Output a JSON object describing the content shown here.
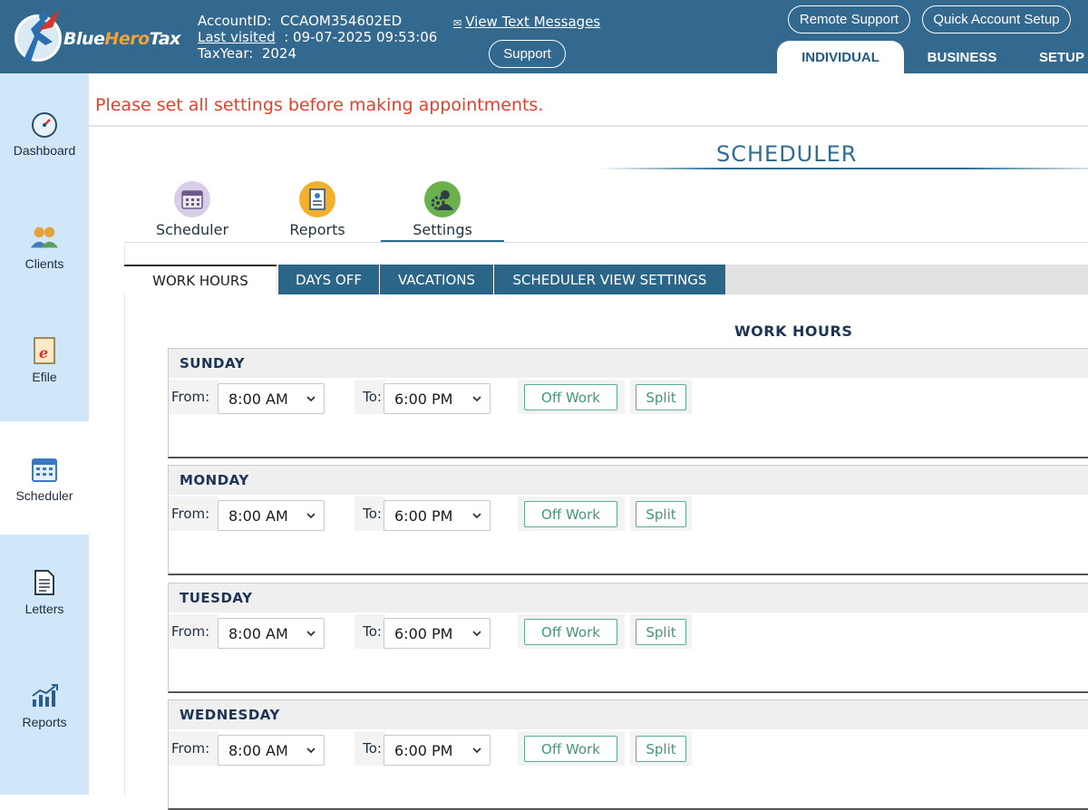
{
  "brand": {
    "part1": "Blue",
    "part2": "Hero",
    "part3": "Tax"
  },
  "account": {
    "id_label": "AccountID:",
    "id_value": "CCAOM354602ED",
    "last_visited_label": "Last visited",
    "last_visited_value": ": 09-07-2025 09:53:06",
    "taxyear_label": "TaxYear:",
    "taxyear_value": "2024"
  },
  "header": {
    "view_text_messages": "View Text Messages",
    "support": "Support",
    "remote_support": "Remote Support",
    "quick_account_setup": "Quick Account Setup",
    "tabs": [
      "INDIVIDUAL",
      "BUSINESS",
      "SETUP"
    ]
  },
  "sidebar": {
    "items": [
      {
        "label": "Dashboard",
        "icon": "gauge-icon"
      },
      {
        "label": "Clients",
        "icon": "people-icon"
      },
      {
        "label": "Efile",
        "icon": "efile-icon"
      },
      {
        "label": "Scheduler",
        "icon": "calendar-icon"
      },
      {
        "label": "Letters",
        "icon": "document-icon"
      },
      {
        "label": "Reports",
        "icon": "chart-icon"
      }
    ],
    "active": "Scheduler"
  },
  "warning": "Please set all settings before making appointments.",
  "page_title": "SCHEDULER",
  "subtabs": [
    {
      "label": "Scheduler",
      "icon": "calendar-icon"
    },
    {
      "label": "Reports",
      "icon": "report-icon"
    },
    {
      "label": "Settings",
      "icon": "settings-icon"
    }
  ],
  "settings_tabs": [
    "WORK HOURS",
    "DAYS OFF",
    "VACATIONS",
    "SCHEDULER VIEW SETTINGS"
  ],
  "section_title": "WORK HOURS",
  "labels": {
    "from": "From:",
    "to": "To:",
    "off_work": "Off Work",
    "split": "Split"
  },
  "days": [
    {
      "name": "SUNDAY",
      "from": "8:00 AM",
      "to": "6:00 PM"
    },
    {
      "name": "MONDAY",
      "from": "8:00 AM",
      "to": "6:00 PM"
    },
    {
      "name": "TUESDAY",
      "from": "8:00 AM",
      "to": "6:00 PM"
    },
    {
      "name": "WEDNESDAY",
      "from": "8:00 AM",
      "to": "6:00 PM"
    }
  ],
  "colors": {
    "header": "#33688f",
    "sidebar": "#cfe7f9",
    "tab_active": "#2b6688",
    "warning": "#e0412a",
    "button_green": "#3f9a73"
  }
}
